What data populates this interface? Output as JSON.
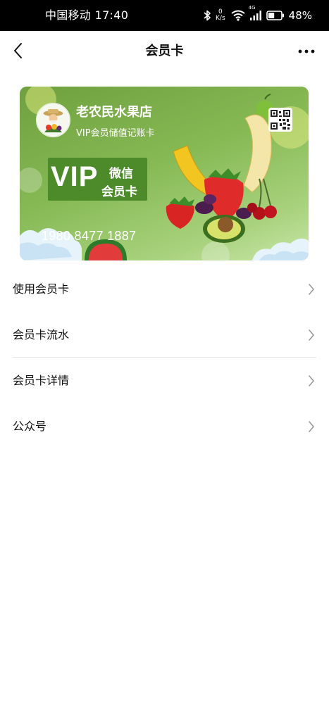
{
  "status_bar": {
    "carrier_time": "中国移动 17:40",
    "net_speed_value": "0",
    "net_speed_unit": "K/s",
    "network_type": "4G",
    "battery_percent": "48%",
    "battery_level": 0.48,
    "icons": [
      "bluetooth-icon",
      "wifi-icon",
      "signal-icon",
      "battery-icon"
    ]
  },
  "nav": {
    "title": "会员卡",
    "back_icon": "chevron-left-icon",
    "more_icon": "more-horizontal-icon"
  },
  "card": {
    "store_name": "老农民水果店",
    "subtitle": "VIP会员储值记账卡",
    "logo_text": "老农民",
    "vip_label": "VIP",
    "badge_line1": "微信",
    "badge_line2": "会员卡",
    "phone": "1980 8477 1887",
    "colors": {
      "background_top": "#6fa03f",
      "background_bottom": "#c9e7a8",
      "badge": "#4c8a2a"
    }
  },
  "menu": {
    "items": [
      {
        "label": "使用会员卡"
      },
      {
        "label": "会员卡流水"
      },
      {
        "label": "会员卡详情"
      },
      {
        "label": "公众号"
      }
    ],
    "arrow_icon": "chevron-right-icon"
  }
}
